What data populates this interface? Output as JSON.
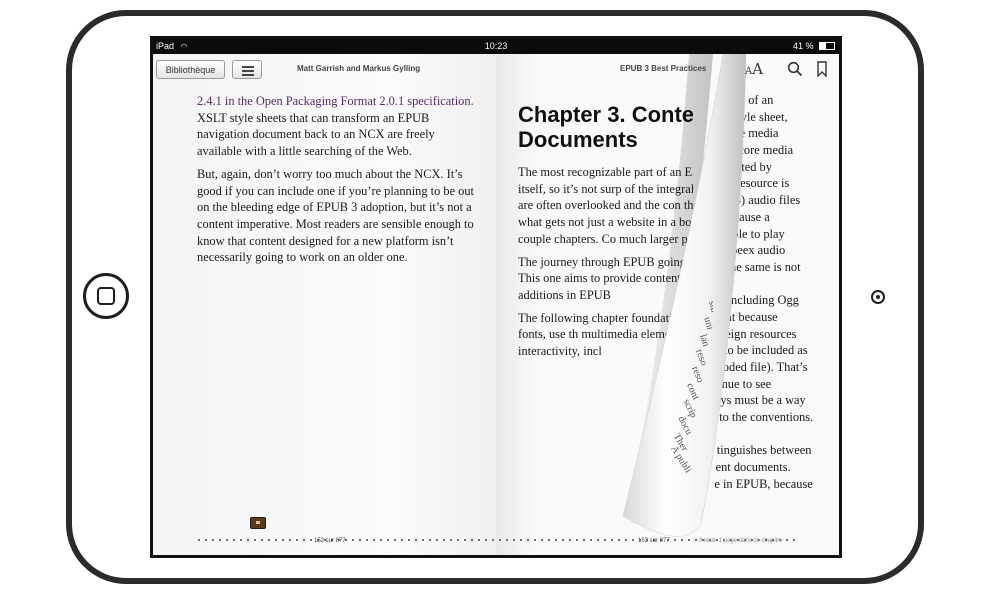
{
  "status": {
    "device": "iPad",
    "time": "10:23",
    "battery": "41 %"
  },
  "toolbar": {
    "library_label": "Bibliothèque",
    "author": "Matt Garrish and Markus Gylling",
    "book_title": "EPUB 3 Best Practices",
    "fontsize_label_small": "A",
    "fontsize_label_large": "A"
  },
  "left_page": {
    "link_text": "2.4.1 in the Open Packaging Format 2.0.1 specification.",
    "p1_rest": " XSLT style sheets that can transform an EPUB navigation document back to an NCX are freely available with a little searching of the Web.",
    "p2": "But, again, don’t worry too much about the NCX. It’s good if you can include one if you’re planning to be out on the bleeding edge of EPUB 3 adoption, but it’s not a content imperative. Most readers are sensible enough to know that content designed for a new platform isn’t necessarily going to work on an older one."
  },
  "right_page": {
    "chapter_title_line1": "Chapter 3. Content",
    "chapter_title_line2": "Documents",
    "p1": "The most recognizable part of an EPUB is the content itself, so it’s not surp of the integral components that m are often overlooked and the con the format is simply what gets not just a website in a box, tho in the last couple chapters. Co much larger puzzle.",
    "p2": "The journey through EPUB going to be spread out acr This one aims to provide content documents, cov and additions in EPUB",
    "p3": "The following chapter foundation by looking embed fonts, use th multimedia elemen synchronizing aud interactivity, incl"
  },
  "curl_page": {
    "lines": [
      ", of an",
      "yle sheet,",
      "e media",
      "core media",
      "rted by",
      "resource is",
      "4) audio files",
      "cause a",
      "ble to play",
      "peex audio",
      "ne same is not",
      "",
      "including Ogg",
      "at because",
      "eign resources",
      "to be included as",
      "oded file). That’s",
      "nue to see",
      "ys must be a way",
      "to the conventions.",
      "",
      "tinguishes between",
      "ent documents.",
      "e in EPUB, because"
    ],
    "back_words": [
      "dul",
      "stu",
      "uni",
      "lan",
      "reso",
      "reso",
      "cont",
      "scrip",
      "docu",
      "Ther",
      "A publi"
    ]
  },
  "footer": {
    "left_page_num": "152 sur 877",
    "right_page_num": "153 sur 877",
    "remaining": "Il reste 1 page dans ce chapitre"
  }
}
